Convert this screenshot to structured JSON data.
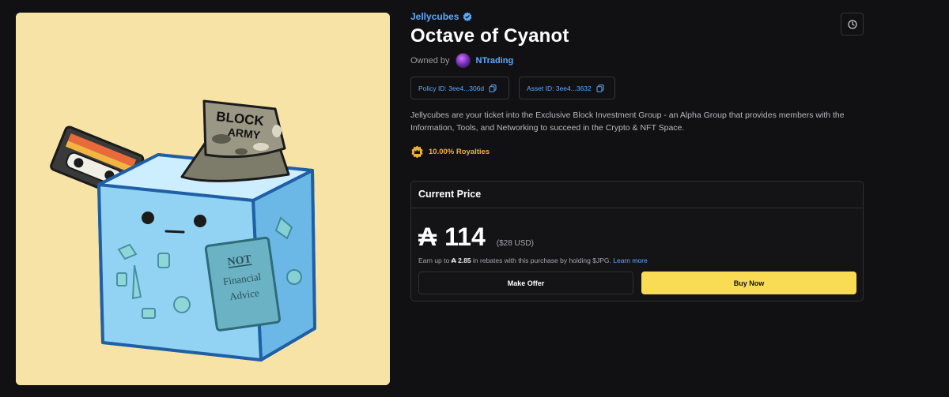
{
  "collection": {
    "name": "Jellycubes",
    "icon": "verified-badge-icon"
  },
  "asset": {
    "title": "Octave of Cyanot"
  },
  "owner": {
    "label": "Owned by",
    "name": "NTrading"
  },
  "ids": {
    "policy": "Policy ID: 3ee4...306d",
    "asset": "Asset ID: 3ee4...3632"
  },
  "description": "Jellycubes are your ticket into the Exclusive Block Investment Group - an Alpha Group that provides members with the Information, Tools, and Networking to succeed in the Crypto & NFT Space.",
  "royalties": "10.00% Royalties",
  "artwork": {
    "cap_text_1": "BLOCK",
    "cap_text_2": "ARMY",
    "book_text_1": "NOT",
    "book_text_2": "Financial",
    "book_text_3": "Advice"
  },
  "price": {
    "header": "Current Price",
    "currency_symbol": "₳",
    "amount": "114",
    "usd": "($28 USD)",
    "rebate_prefix": "Earn up to",
    "rebate_amount": "₳ 2.85",
    "rebate_suffix": "in rebates with this purchase by holding $JPG.",
    "learn_more": "Learn more"
  },
  "buttons": {
    "make_offer": "Make Offer",
    "buy_now": "Buy Now"
  },
  "colors": {
    "background": "#111113",
    "accent_blue": "#5da9ff",
    "buy_yellow": "#f9dc54",
    "royalty_orange": "#f0b03c",
    "art_background": "#f7e3a6"
  }
}
